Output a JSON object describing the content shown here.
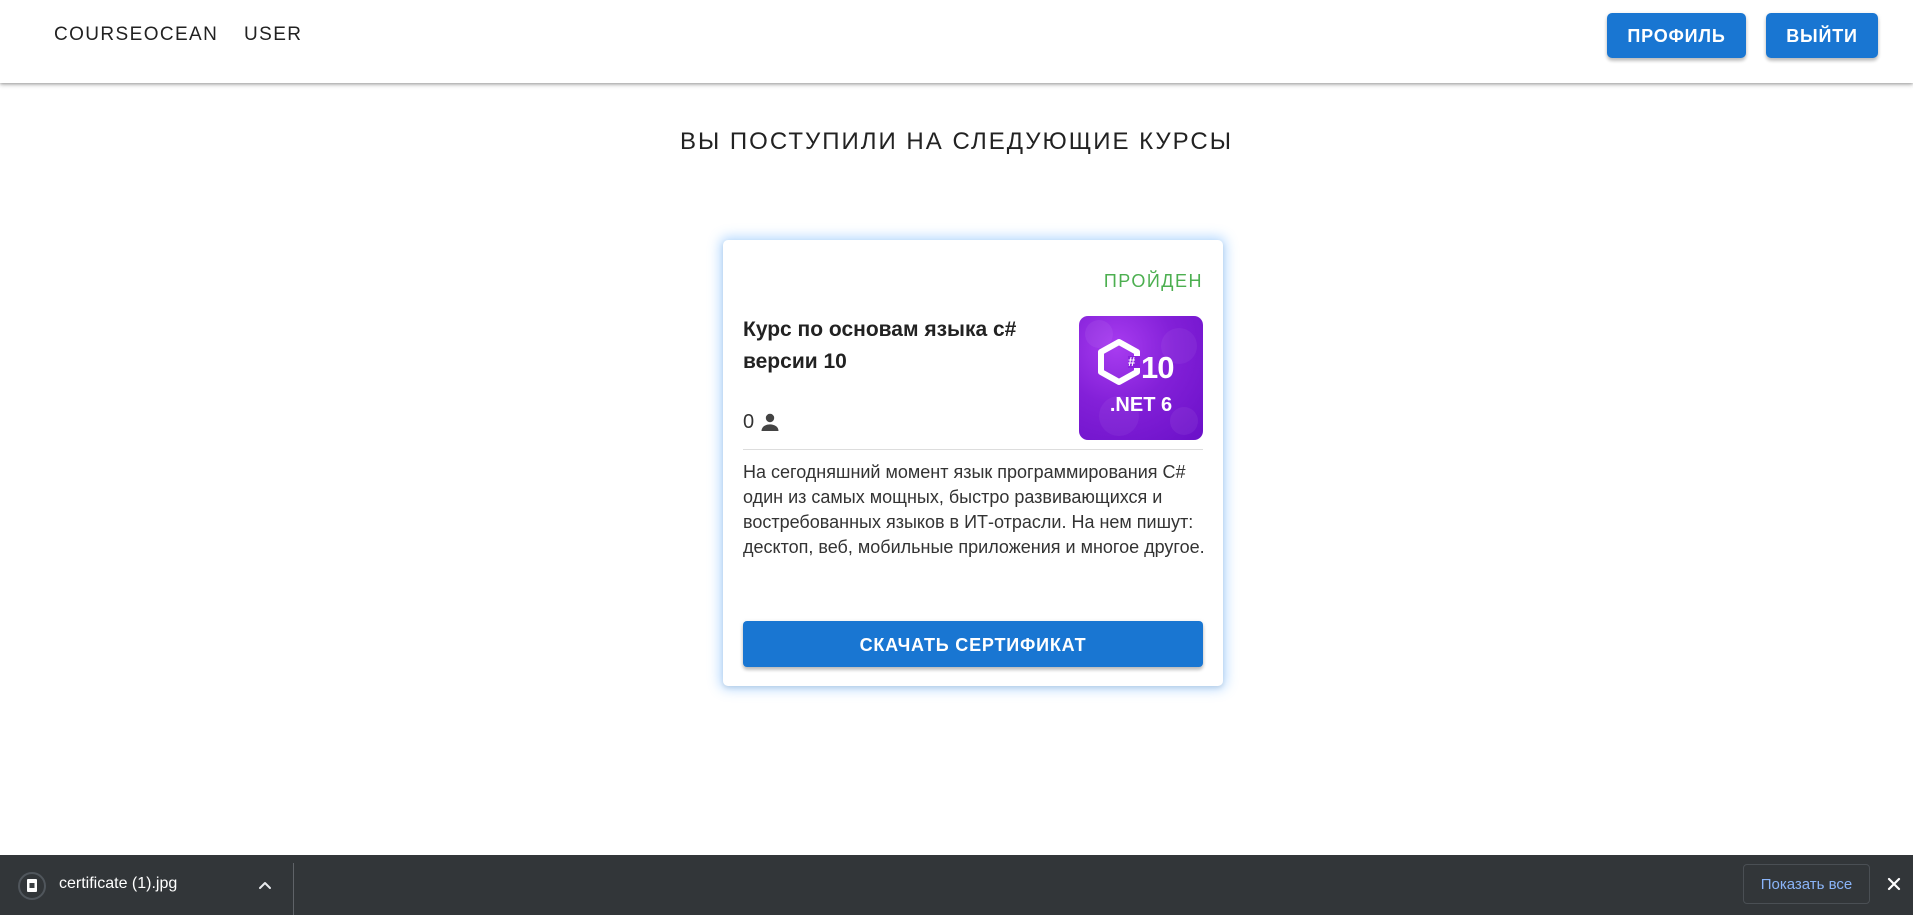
{
  "header": {
    "brand": "COURSEOCEAN",
    "user_link": "USER",
    "profile_button": "ПРОФИЛЬ",
    "logout_button": "ВЫЙТИ"
  },
  "main": {
    "title": "ВЫ ПОСТУПИЛИ НА СЛЕДУЮЩИЕ КУРСЫ"
  },
  "course_card": {
    "status": "ПРОЙДЕН",
    "title": "Курс по основам языка c# версии 10",
    "participants_count": "0",
    "participants_icon": "person-icon",
    "image": {
      "logo_top": "10",
      "logo_hash": "#",
      "logo_bottom": ".NET 6",
      "background_color": "#8a22dd"
    },
    "description": "На сегодняшний момент язык программирования C# один из самых мощных, быстро развивающихся и востребованных языков в ИТ-отрасли. На нем пишут: десктоп, веб, мобильные приложения и многое другое.",
    "download_button": "СКАЧАТЬ СЕРТИФИКАТ"
  },
  "download_bar": {
    "filename": "certificate (1).jpg",
    "show_all": "Показать все"
  },
  "colors": {
    "primary": "#1976d2",
    "status_success": "#4caf50",
    "download_bar_bg": "#323639",
    "link_blue": "#8ab4f8"
  }
}
